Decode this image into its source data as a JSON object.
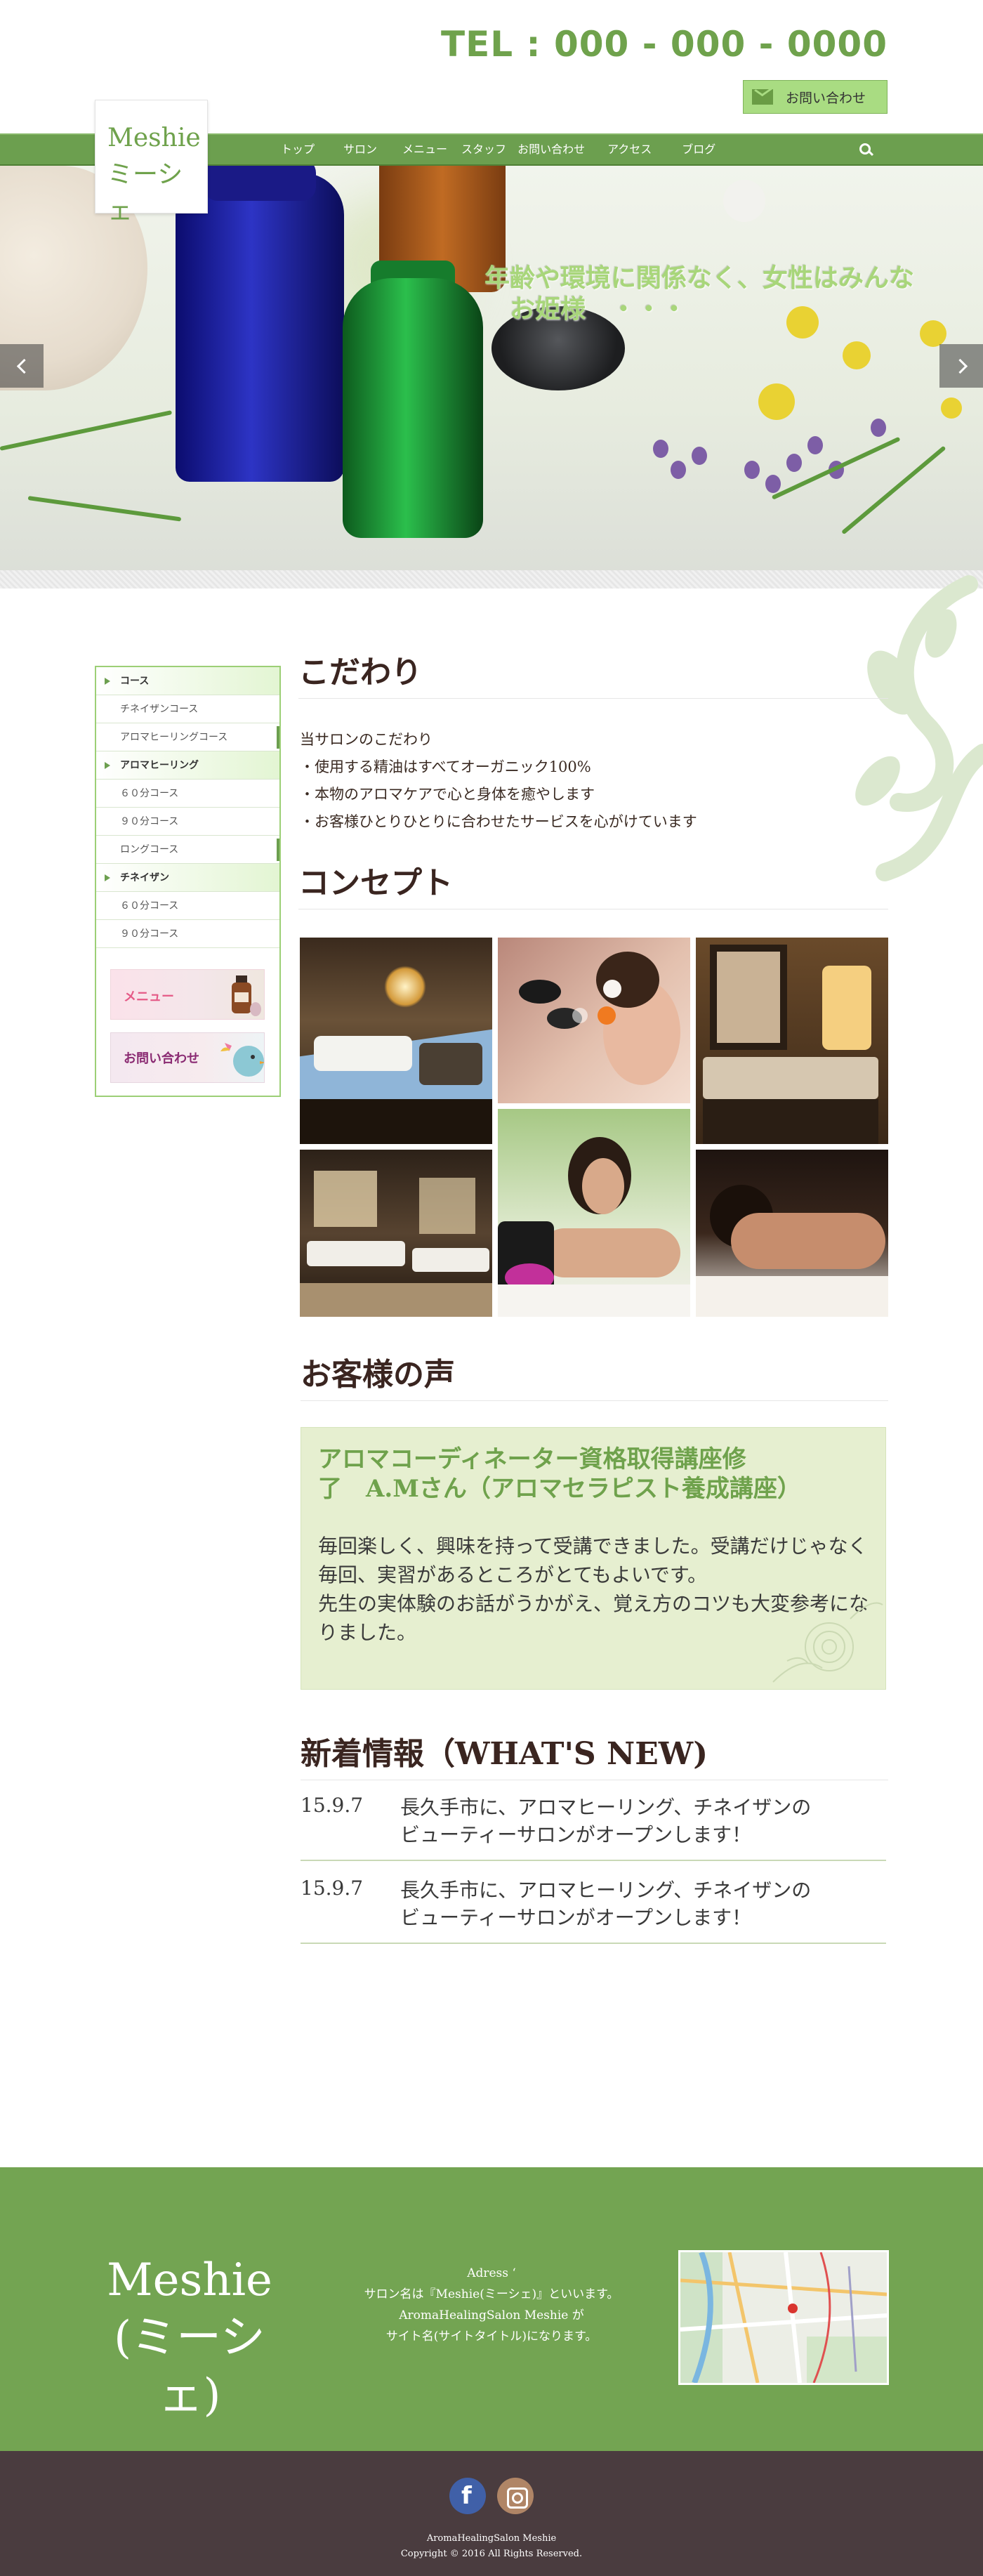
{
  "header": {
    "tel": "TEL : 000 - 000 - 0000",
    "contact_button": "お問い合わせ",
    "logo_line1": "Meshie",
    "logo_line2": "ミーシェ"
  },
  "nav": {
    "items": [
      "トップ",
      "サロン",
      "メニュー",
      "スタッフ",
      "お問い合わせ",
      "アクセス",
      "ブログ"
    ],
    "search_icon": "search-icon"
  },
  "hero": {
    "caption": "年齢や環境に関係なく、女性はみんな\n　お姫様　・・・"
  },
  "sidebar": {
    "items": [
      {
        "label": "コース",
        "type": "head"
      },
      {
        "label": "チネイザンコース",
        "type": "sub"
      },
      {
        "label": "アロマヒーリングコース",
        "type": "sub"
      },
      {
        "label": "アロマヒーリング",
        "type": "head"
      },
      {
        "label": "６０分コース",
        "type": "sub"
      },
      {
        "label": "９０分コース",
        "type": "sub"
      },
      {
        "label": "ロングコース",
        "type": "sub"
      },
      {
        "label": "チネイザン",
        "type": "head"
      },
      {
        "label": "６０分コース",
        "type": "sub"
      },
      {
        "label": "９０分コース",
        "type": "sub"
      }
    ],
    "banner_menu": "メニュー",
    "banner_contact": "お問い合わせ"
  },
  "kodawari": {
    "title": "こだわり",
    "lines": [
      "当サロンのこだわり",
      "・使用する精油はすべてオーガニック100%",
      "・本物のアロマケアで心と身体を癒やします",
      "・お客様ひとりひとりに合わせたサービスを心がけています"
    ]
  },
  "concept": {
    "title": "コンセプト"
  },
  "voice": {
    "title": "お客様の声",
    "heading": "アロマコーディネーター資格取得講座修\n了　A.Mさん（アロマセラピスト養成講座）",
    "body": "毎回楽しく、興味を持って受講できました。受講だけじゃなく毎回、実習があるところがとてもよいです。\n先生の実体験のお話がうかがえ、覚え方のコツも大変参考になりました。"
  },
  "news": {
    "title": "新着情報（WHAT'S NEW)",
    "items": [
      {
        "date": "15.9.7",
        "text": "長久手市に、アロマヒーリング、チネイザンの\nビューティーサロンがオープンします！"
      },
      {
        "date": "15.9.7",
        "text": "長久手市に、アロマヒーリング、チネイザンの\nビューティーサロンがオープンします！"
      }
    ]
  },
  "footer": {
    "logo_line1": "Meshie",
    "logo_line2": "(ミーシェ)",
    "address_label": "Adress ‘",
    "line1": "サロン名は『Meshie(ミーシェ)』といいます。",
    "line2": "AromaHealingSalon Meshie が",
    "line3": "サイト名(サイトタイトル)になります。",
    "bottom_name": "AromaHealingSalon Meshie",
    "copyright": "Copyright © 2016 All Rights Reserved."
  },
  "colors": {
    "brand_green": "#6fa24c",
    "nav_green": "#6c9f4f",
    "footer_green": "#73a452",
    "footer_bottom": "#4a3c3f",
    "voice_bg": "#e6efd0"
  }
}
